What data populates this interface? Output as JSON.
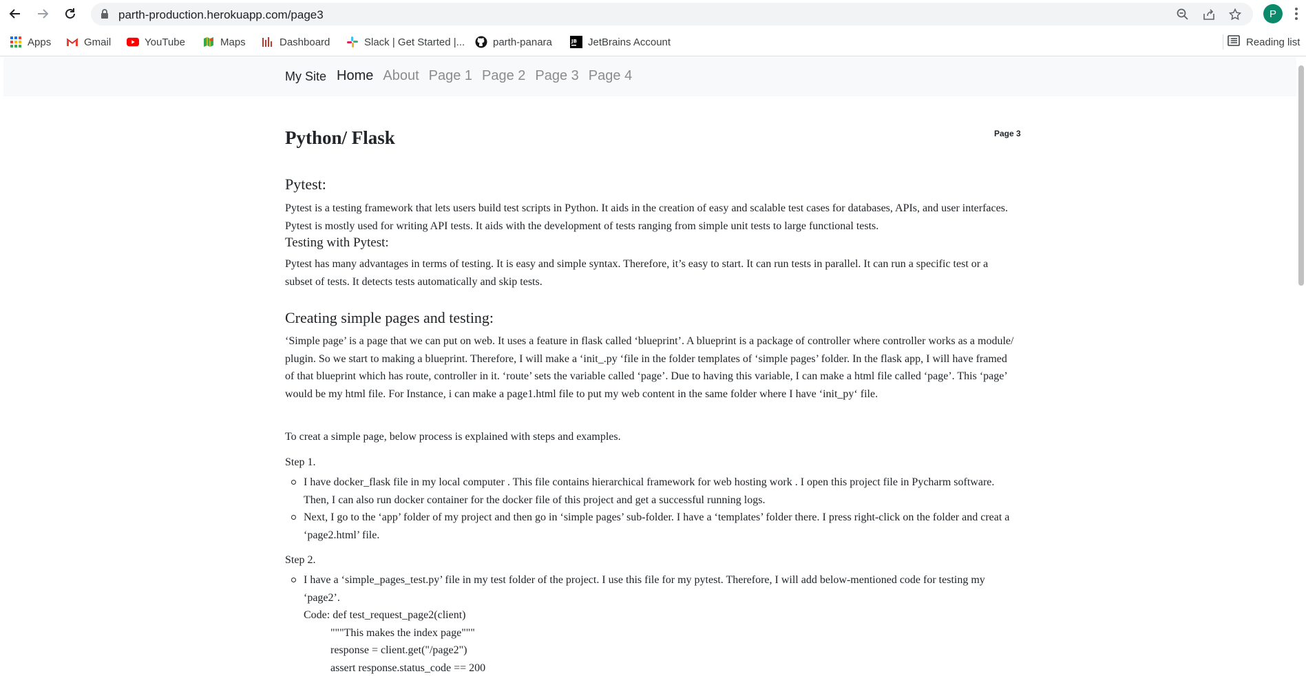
{
  "browser": {
    "url": "parth-production.herokuapp.com/page3",
    "avatar_letter": "P",
    "accent": "#0b8a6b"
  },
  "bookmarks": {
    "items": [
      {
        "label": "Apps",
        "icon": "apps-grid-icon"
      },
      {
        "label": "Gmail",
        "icon": "gmail-icon"
      },
      {
        "label": "YouTube",
        "icon": "youtube-icon"
      },
      {
        "label": "Maps",
        "icon": "maps-icon"
      },
      {
        "label": "Dashboard",
        "icon": "dashboard-icon"
      },
      {
        "label": "Slack | Get Started |...",
        "icon": "slack-icon"
      },
      {
        "label": "parth-panara",
        "icon": "github-icon"
      },
      {
        "label": "JetBrains Account",
        "icon": "jetbrains-icon"
      }
    ],
    "reading_list": "Reading list"
  },
  "site_nav": {
    "brand": "My Site",
    "links": [
      "Home",
      "About",
      "Page 1",
      "Page 2",
      "Page 3",
      "Page 4"
    ],
    "active": "Home"
  },
  "page": {
    "title": "Python/ Flask",
    "page_label": "Page 3",
    "pytest_heading": "Pytest:",
    "pytest_para": "Pytest is a testing framework that lets users build test scripts in Python. It aids in the creation of easy and scalable test cases for databases, APIs, and user interfaces. Pytest is mostly used for writing API tests. It aids with the development of tests ranging from simple unit tests to large functional tests.",
    "testing_heading": "Testing with Pytest:",
    "testing_para": "Pytest has many advantages in terms of testing. It is easy and simple syntax. Therefore, it’s easy to start. It can run tests in parallel. It can run a specific test or a subset of tests. It detects tests automatically and skip tests.",
    "creating_heading": "Creating simple pages and testing:",
    "creating_para": "‘Simple page’ is a page that we can put on web. It uses a feature in flask called ‘blueprint’. A blueprint is a package of controller where controller works as a module/ plugin. So we start to making a blueprint. Therefore, I will make a ‘init_.py ‘file in the folder templates of ‘simple pages’ folder. In the flask app, I will have framed of that blueprint which has route, controller in it. ‘route’ sets the variable called ‘page’. Due to having this variable, I can make a html file called ‘page’. This ‘page’ would be my html file. For Instance, i can make a page1.html file to put my web content in the same folder where I have ‘init_py‘ file.",
    "process_para": "To creat a simple page, below process is explained with steps and examples.",
    "step1_label": "Step 1.",
    "step1_items": [
      "I have docker_flask file in my local computer . This file contains hierarchical framework for web hosting work . I open this project file in Pycharm software. Then, I can also run docker container for the docker file of this project and get a successful running logs.",
      "Next, I go to the ‘app’ folder of my project and then go in ‘simple pages’ sub-folder. I have a ‘templates’ folder there. I press right-click on the folder and creat a ‘page2.html’ file."
    ],
    "step2_label": "Step 2.",
    "step2_items": [
      "I have a ‘simple_pages_test.py’ file in my test folder of the project. I use this file for my pytest. Therefore, I will add below-mentioned code for testing my ‘page2’."
    ],
    "code_lines": [
      "Code: def test_request_page2(client)",
      "\"\"\"This makes the index page\"\"\"",
      "response = client.get(\"/page2\")",
      "assert response.status_code == 200"
    ]
  }
}
